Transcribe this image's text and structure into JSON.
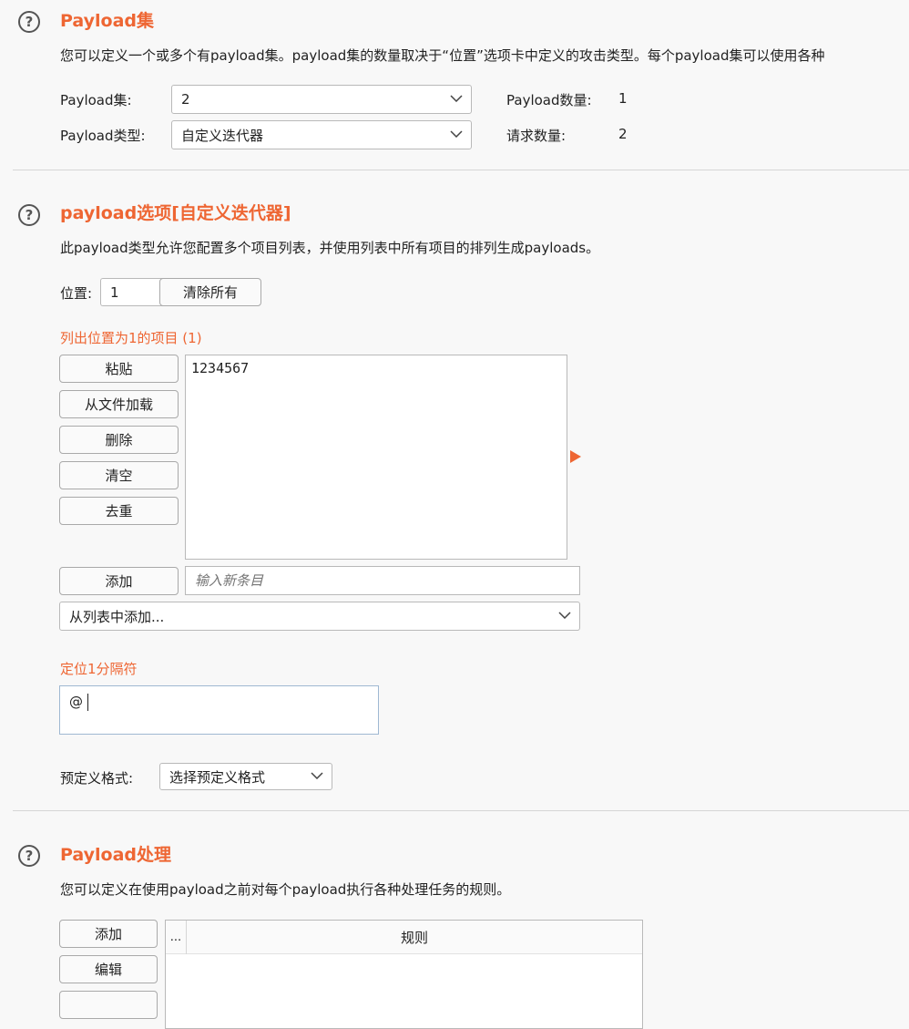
{
  "payload_sets": {
    "title": "Payload集",
    "description": "您可以定义一个或多个有payload集。payload集的数量取决于“位置”选项卡中定义的攻击类型。每个payload集可以使用各种",
    "set_label": "Payload集:",
    "set_value": "2",
    "type_label": "Payload类型:",
    "type_value": "自定义迭代器",
    "count_label": "Payload数量:",
    "count_value": "1",
    "requests_label": "请求数量:",
    "requests_value": "2"
  },
  "payload_options": {
    "title": "payload选项[自定义迭代器]",
    "description": "此payload类型允许您配置多个项目列表，并使用列表中所有项目的排列生成payloads。",
    "position_label": "位置:",
    "position_value": "1",
    "clear_all_label": "清除所有",
    "list_heading": "列出位置为1的项目 (1)",
    "paste_label": "粘贴",
    "load_label": "从文件加载",
    "remove_label": "删除",
    "clear_label": "清空",
    "dedupe_label": "去重",
    "items": [
      "1234567"
    ],
    "add_label": "添加",
    "new_item_placeholder": "输入新条目",
    "add_from_list_label": "从列表中添加...",
    "separator_heading": "定位1分隔符",
    "separator_value": "@",
    "predefined_label": "预定义格式:",
    "predefined_value": "选择预定义格式"
  },
  "payload_processing": {
    "title": "Payload处理",
    "description": "您可以定义在使用payload之前对每个payload执行各种处理任务的规则。",
    "add_label": "添加",
    "edit_label": "编辑",
    "table_col_enabled": "...",
    "table_col_rule": "规则"
  },
  "colors": {
    "accent": "#ee6633",
    "background": "#f8f8f8",
    "border": "#b9b9b9"
  },
  "icons": {
    "help": "help-icon",
    "dropdown": "chevron-down-icon",
    "expand": "triangle-right-icon"
  }
}
